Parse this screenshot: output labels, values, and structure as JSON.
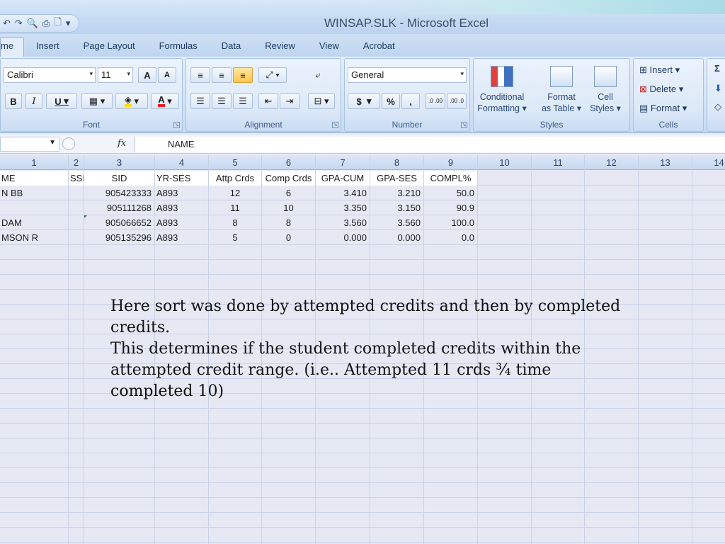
{
  "window": {
    "title": "WINSAP.SLK - Microsoft Excel"
  },
  "qat": {
    "undo": "↶",
    "redo": "↷",
    "print_preview": "🔍",
    "print": "⎙",
    "new": "🗋",
    "more": "▾"
  },
  "tabs": [
    "me",
    "Insert",
    "Page Layout",
    "Formulas",
    "Data",
    "Review",
    "View",
    "Acrobat"
  ],
  "ribbon": {
    "font": {
      "name": "Calibri",
      "size": "11",
      "bold": "B",
      "italic": "I",
      "underline": "U",
      "grow": "A",
      "shrink": "A",
      "fill_color": "#ffe000",
      "font_color": "#e02020",
      "label": "Font"
    },
    "alignment": {
      "label": "Alignment"
    },
    "number": {
      "format": "General",
      "currency": "$",
      "percent": "%",
      "comma": ",",
      "inc_decimal": ".0 .00",
      "dec_decimal": ".00 .0",
      "label": "Number"
    },
    "styles": {
      "conditional": [
        "Conditional",
        "Formatting ▾"
      ],
      "format_table": [
        "Format",
        "as Table ▾"
      ],
      "cell_styles": [
        "Cell",
        "Styles ▾"
      ],
      "label": "Styles"
    },
    "cells": {
      "insert": "Insert ▾",
      "delete": "Delete ▾",
      "format": "Format ▾",
      "label": "Cells"
    },
    "editing": {
      "sum": "Σ"
    }
  },
  "formula_bar": {
    "name_box": "",
    "fx": "fx",
    "value": "NAME"
  },
  "columns": [
    "1",
    "2",
    "3",
    "4",
    "5",
    "6",
    "7",
    "8",
    "9",
    "10",
    "11",
    "12",
    "13",
    "14"
  ],
  "header_row": [
    "ME",
    "SSI",
    "SID",
    "YR-SES",
    "Attp Crds",
    "Comp Crds",
    "GPA-CUM",
    "GPA-SES",
    "COMPL%"
  ],
  "rows": [
    [
      "N BB",
      "",
      "905423333",
      "A893",
      "12",
      "6",
      "3.410",
      "3.210",
      "50.0"
    ],
    [
      "",
      "",
      "905111268",
      "A893",
      "11",
      "10",
      "3.350",
      "3.150",
      "90.9"
    ],
    [
      "DAM",
      "",
      "905066652",
      "A893",
      "8",
      "8",
      "3.560",
      "3.560",
      "100.0"
    ],
    [
      "MSON R",
      "",
      "905135296",
      "A893",
      "5",
      "0",
      "0.000",
      "0.000",
      "0.0"
    ]
  ],
  "note": {
    "line1": "Here sort was done by attempted credits and then by completed credits.",
    "line2": "This determines if the student completed credits within the attempted credit range. (i.e.. Attempted 11 crds ¾ time completed 10)"
  }
}
